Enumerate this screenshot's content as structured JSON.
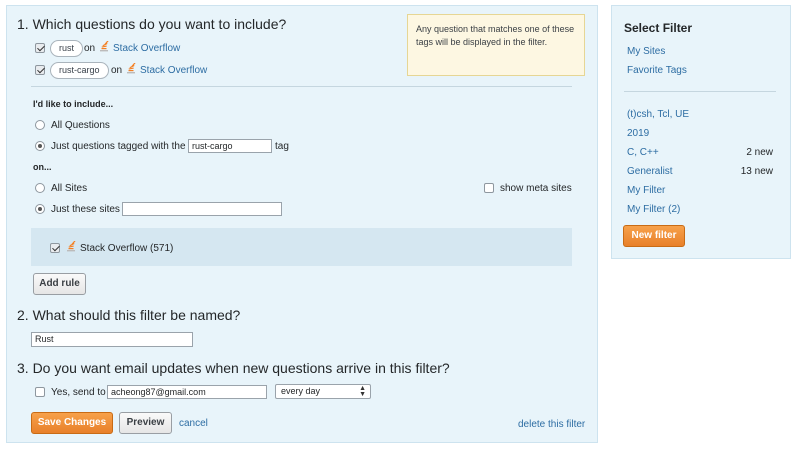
{
  "section1": {
    "heading": "1. Which questions do you want to include?",
    "note": "Any question that matches one of these tags will be displayed in the filter.",
    "rules": [
      {
        "tag": "rust",
        "on": "on",
        "site": "Stack Overflow",
        "checked": true
      },
      {
        "tag": "rust-cargo",
        "on": "on",
        "site": "Stack Overflow",
        "checked": true
      }
    ],
    "include_label": "I'd like to include...",
    "all_questions": "All Questions",
    "just_tagged_prefix": "Just questions tagged with the",
    "just_tagged_value": "rust-cargo",
    "just_tagged_suffix": "tag",
    "on_label": "on...",
    "all_sites": "All Sites",
    "show_meta": "show meta sites",
    "just_these_sites": "Just these sites",
    "just_these_sites_value": "",
    "site_item": "Stack Overflow (571)",
    "add_rule": "Add rule"
  },
  "section2": {
    "heading": "2. What should this filter be named?",
    "name_value": "Rust"
  },
  "section3": {
    "heading": "3. Do you want email updates when new questions arrive in this filter?",
    "send_label": "Yes, send to",
    "email_value": "acheong87@gmail.com",
    "frequency": "every day"
  },
  "actions": {
    "save": "Save Changes",
    "preview": "Preview",
    "cancel": "cancel",
    "delete": "delete this filter"
  },
  "sidebar": {
    "title": "Select Filter",
    "top_links": [
      "My Sites",
      "Favorite Tags"
    ],
    "filters": [
      {
        "label": "(t)csh, Tcl, UE",
        "count": ""
      },
      {
        "label": "2019",
        "count": ""
      },
      {
        "label": "C, C++",
        "count": "2 new"
      },
      {
        "label": "Generalist",
        "count": "13 new"
      },
      {
        "label": "My Filter",
        "count": ""
      },
      {
        "label": "My Filter (2)",
        "count": ""
      }
    ],
    "new_filter": "New filter"
  },
  "colors": {
    "panel_bg": "#e8f4fa",
    "link": "#2d6da3",
    "accent_orange": "#e8802a",
    "note_bg": "#fdf7e2"
  }
}
